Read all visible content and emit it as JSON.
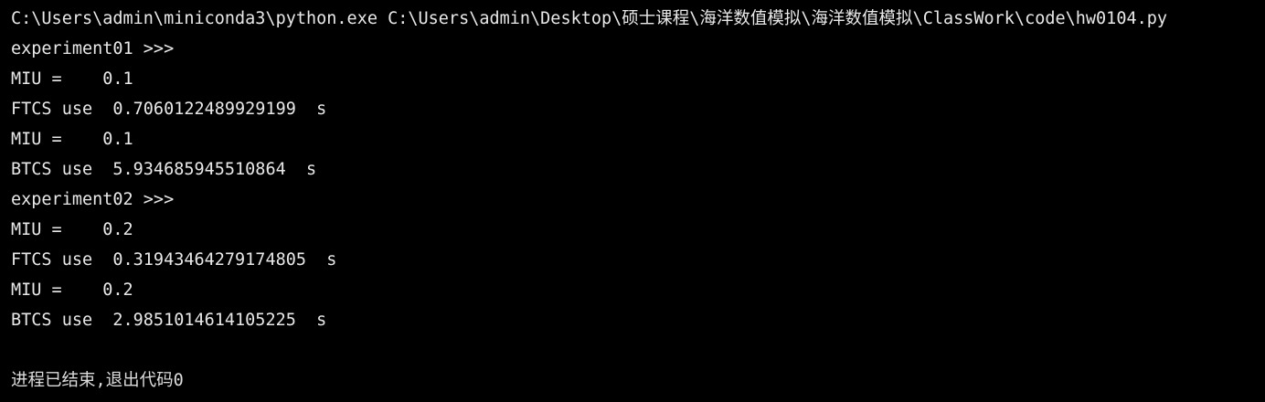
{
  "console": {
    "command": "C:\\Users\\admin\\miniconda3\\python.exe C:\\Users\\admin\\Desktop\\硕士课程\\海洋数值模拟\\海洋数值模拟\\ClassWork\\code\\hw0104.py",
    "lines": [
      "experiment01 >>>",
      "MIU =    0.1",
      "FTCS use  0.7060122489929199  s",
      "MIU =    0.1",
      "BTCS use  5.934685945510864  s",
      "experiment02 >>>",
      "MIU =    0.2",
      "FTCS use  0.31943464279174805  s",
      "MIU =    0.2",
      "BTCS use  2.9851014614105225  s"
    ],
    "exit_message": "进程已结束,退出代码0"
  }
}
